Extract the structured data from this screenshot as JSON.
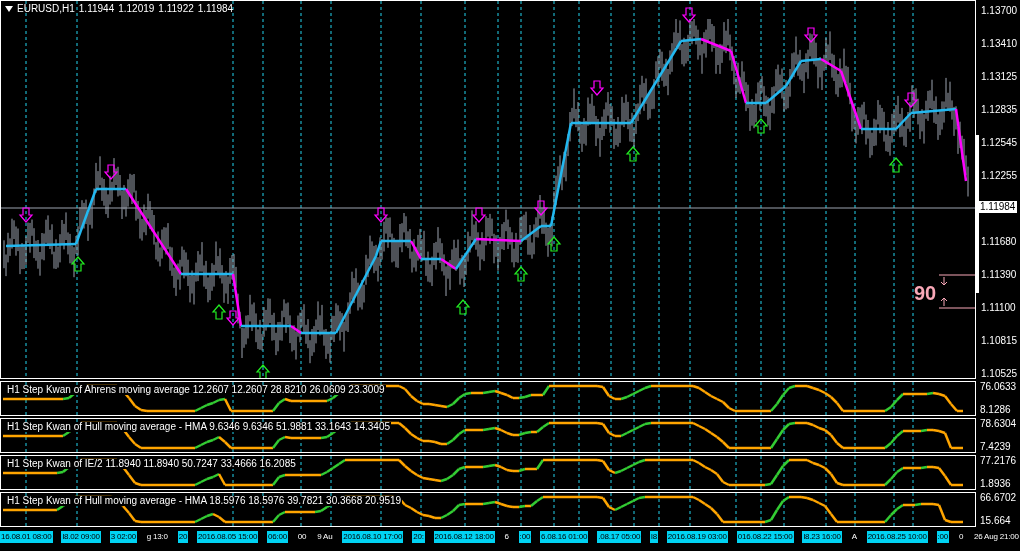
{
  "symbol_bar": {
    "symbol": "EURUSD,H1",
    "ohlc": [
      "1.11944",
      "1.12019",
      "1.11922",
      "1.11984"
    ]
  },
  "price_axis": {
    "labels": [
      "1.13700",
      "1.13410",
      "1.13125",
      "1.12835",
      "1.12545",
      "1.12255",
      "1.11680",
      "1.11390",
      "1.11100",
      "1.10815",
      "1.10525"
    ],
    "current_price": "1.11984"
  },
  "ruler": {
    "value": "90"
  },
  "indicators": [
    {
      "title": "H1 Step Kwan of Ahrens moving average 12.2607 12.2607 28.8210 26.0609 23.3009",
      "axis_max": "76.0633",
      "axis_min": "8.1286"
    },
    {
      "title": "H1 Step Kwan of Hull moving average - HMA 9.6346 9.6346 51.9881 33.1643 14.3405",
      "axis_max": "78.6304",
      "axis_min": "7.4239"
    },
    {
      "title": "H1 Step Kwan of IE/2 11.8940 11.8940 50.7247 33.4666 16.2085",
      "axis_max": "77.2176",
      "axis_min": "1.8936"
    },
    {
      "title": "H1 Step Kwan of Hull moving average - HMA 18.5976 18.5976 39.7821 30.3668 20.9519",
      "axis_max": "66.6702",
      "axis_min": "15.664"
    }
  ],
  "time_axis": [
    {
      "text": "16.08.01 08:00",
      "highlighted": true
    },
    {
      "text": "l8.02 09:00",
      "highlighted": true
    },
    {
      "text": "3 02:00",
      "highlighted": true
    },
    {
      "text": "g 13:0",
      "highlighted": false
    },
    {
      "text": "20",
      "highlighted": true
    },
    {
      "text": "2016.08.05 15:00",
      "highlighted": true
    },
    {
      "text": "06:00",
      "highlighted": true
    },
    {
      "text": "00",
      "highlighted": false
    },
    {
      "text": "9 Au",
      "highlighted": false
    },
    {
      "text": "2016.08.10 17:00",
      "highlighted": true
    },
    {
      "text": "20:",
      "highlighted": true
    },
    {
      "text": "2016.08.12 18:00",
      "highlighted": true
    },
    {
      "text": "6",
      "highlighted": false
    },
    {
      "text": ":00",
      "highlighted": true
    },
    {
      "text": "6.08.16 01:00",
      "highlighted": true
    },
    {
      "text": ".08.17 05:00",
      "highlighted": true
    },
    {
      "text": "l8",
      "highlighted": true
    },
    {
      "text": "2016.08.19 03:00",
      "highlighted": true
    },
    {
      "text": "016.08.22 15:00",
      "highlighted": true
    },
    {
      "text": "l8.23 16:00",
      "highlighted": true
    },
    {
      "text": "A",
      "highlighted": false
    },
    {
      "text": "2016.08.25 10:00",
      "highlighted": true
    },
    {
      "text": ":00",
      "highlighted": true
    },
    {
      "text": "0",
      "highlighted": false
    },
    {
      "text": "26 Aug 21:00",
      "highlighted": false
    }
  ]
}
